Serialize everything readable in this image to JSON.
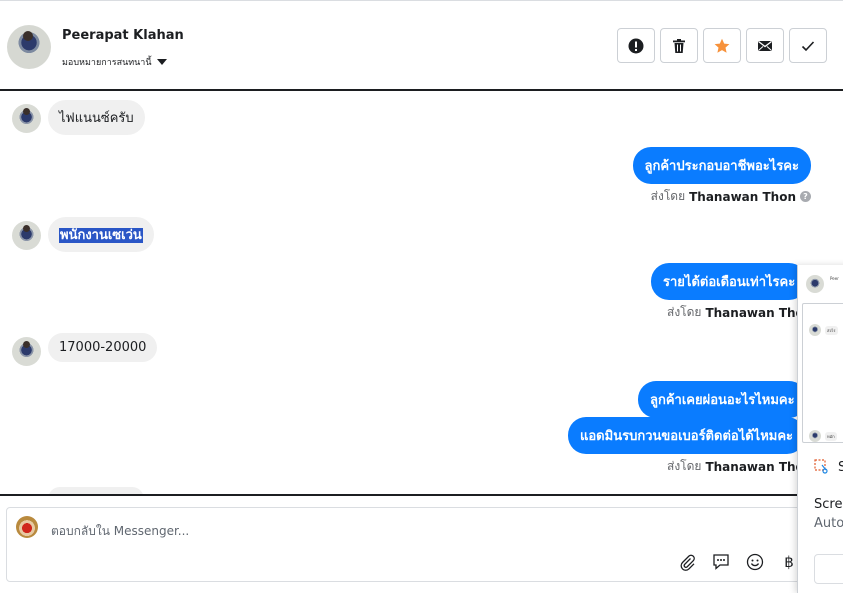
{
  "header": {
    "name": "Peerapat Klahan",
    "assign_label": "มอบหมายการสนทนานี้",
    "buttons": [
      {
        "name": "report-button",
        "icon": "exclamation-icon"
      },
      {
        "name": "delete-button",
        "icon": "trash-icon"
      },
      {
        "name": "star-button",
        "icon": "star-icon",
        "color": "#f7923b"
      },
      {
        "name": "mark-unread-button",
        "icon": "envelope-icon"
      },
      {
        "name": "mark-done-button",
        "icon": "checkmark-icon"
      }
    ]
  },
  "messages": [
    {
      "dir": "in",
      "text": "ไฟแนนซ์ครับ"
    },
    {
      "dir": "out",
      "text": "ลูกค้าประกอบอาชีพอะไรคะ",
      "sent_by_prefix": "ส่งโดย",
      "sent_by": "Thanawan Thon"
    },
    {
      "dir": "in",
      "text": "พนักงานเซเว่น",
      "selected": true
    },
    {
      "dir": "out",
      "text": "รายได้ต่อเดือนเท่าไรคะ",
      "sent_by_prefix": "ส่งโดย",
      "sent_by": "Thanawan Thon"
    },
    {
      "dir": "in",
      "text": "17000-20000"
    },
    {
      "dir": "out",
      "text": "ลูกค้าเคยผ่อนอะไรไหมคะ"
    },
    {
      "dir": "out",
      "text": "แอดมินรบกวนขอเบอร์ติดต่อได้ไหมคะ",
      "sent_by_prefix": "ส่งโดย",
      "sent_by": "Thanawan Thon"
    }
  ],
  "composer": {
    "placeholder": "ตอบกลับใน Messenger..."
  },
  "overlay": {
    "header_tiny": "Peer",
    "msg1_tiny": "ส่งไร",
    "msg2_tiny": "หมัก",
    "line1": "S",
    "line2": "Scree",
    "line3": "Auto"
  },
  "colors": {
    "accent": "#0a7cff",
    "star": "#f7923b",
    "selection": "#2a56c6"
  }
}
